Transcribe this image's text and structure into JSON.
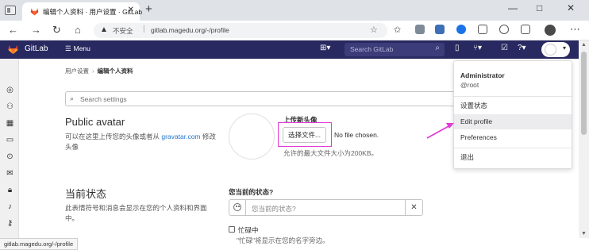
{
  "browser": {
    "tab_title": "编辑个人资料 · 用户设置 · GitLab",
    "tab_close": "✕",
    "new_tab": "+",
    "insecure_label": "不安全",
    "url": "gitlab.magedu.org/-/profile",
    "status_url": "gitlab.magedu.org/-/profile",
    "window_controls": [
      "—",
      "□",
      "✕"
    ],
    "icons": [
      "windows-tabs-icon",
      "back-arrow-icon",
      "refresh-icon",
      "home-icon",
      "warning-icon",
      "star-icon",
      "extension-icons",
      "profile-icon",
      "more-icon"
    ]
  },
  "gitlab": {
    "brand": "GitLab",
    "menu_label": "Menu",
    "search_placeholder": "Search GitLab",
    "accent_color": "#292961",
    "logo_color": "#e24329"
  },
  "breadcrumb": {
    "parent": "用户设置",
    "current": "编辑个人资料"
  },
  "search_settings": {
    "placeholder": "Search settings"
  },
  "public_avatar": {
    "title": "Public avatar",
    "desc_prefix": "可以在这里上传您的头像或者从 ",
    "desc_link": "gravatar.com",
    "desc_suffix": " 修改头像",
    "upload_title": "上传新头像",
    "choose_button": "选择文件...",
    "no_file": "No file chosen.",
    "max_size": "允许的最大文件大小为200KB。"
  },
  "current_status": {
    "title": "当前状态",
    "desc": "此表情符号和消息会显示在您的个人资料和界面中。",
    "label": "您当前的状态?",
    "placeholder": "您当前的状态?",
    "clear": "✕",
    "busy_label": "忙碌中",
    "busy_help": "\"忙碌\"将显示在您的名字旁边。"
  },
  "dropdown": {
    "name": "Administrator",
    "username": "@root",
    "items": [
      "设置状态",
      "Edit profile",
      "Preferences",
      "退出"
    ],
    "hovered_item": "Edit profile"
  },
  "annotation": {
    "highlight_color": "#e23ad7"
  }
}
